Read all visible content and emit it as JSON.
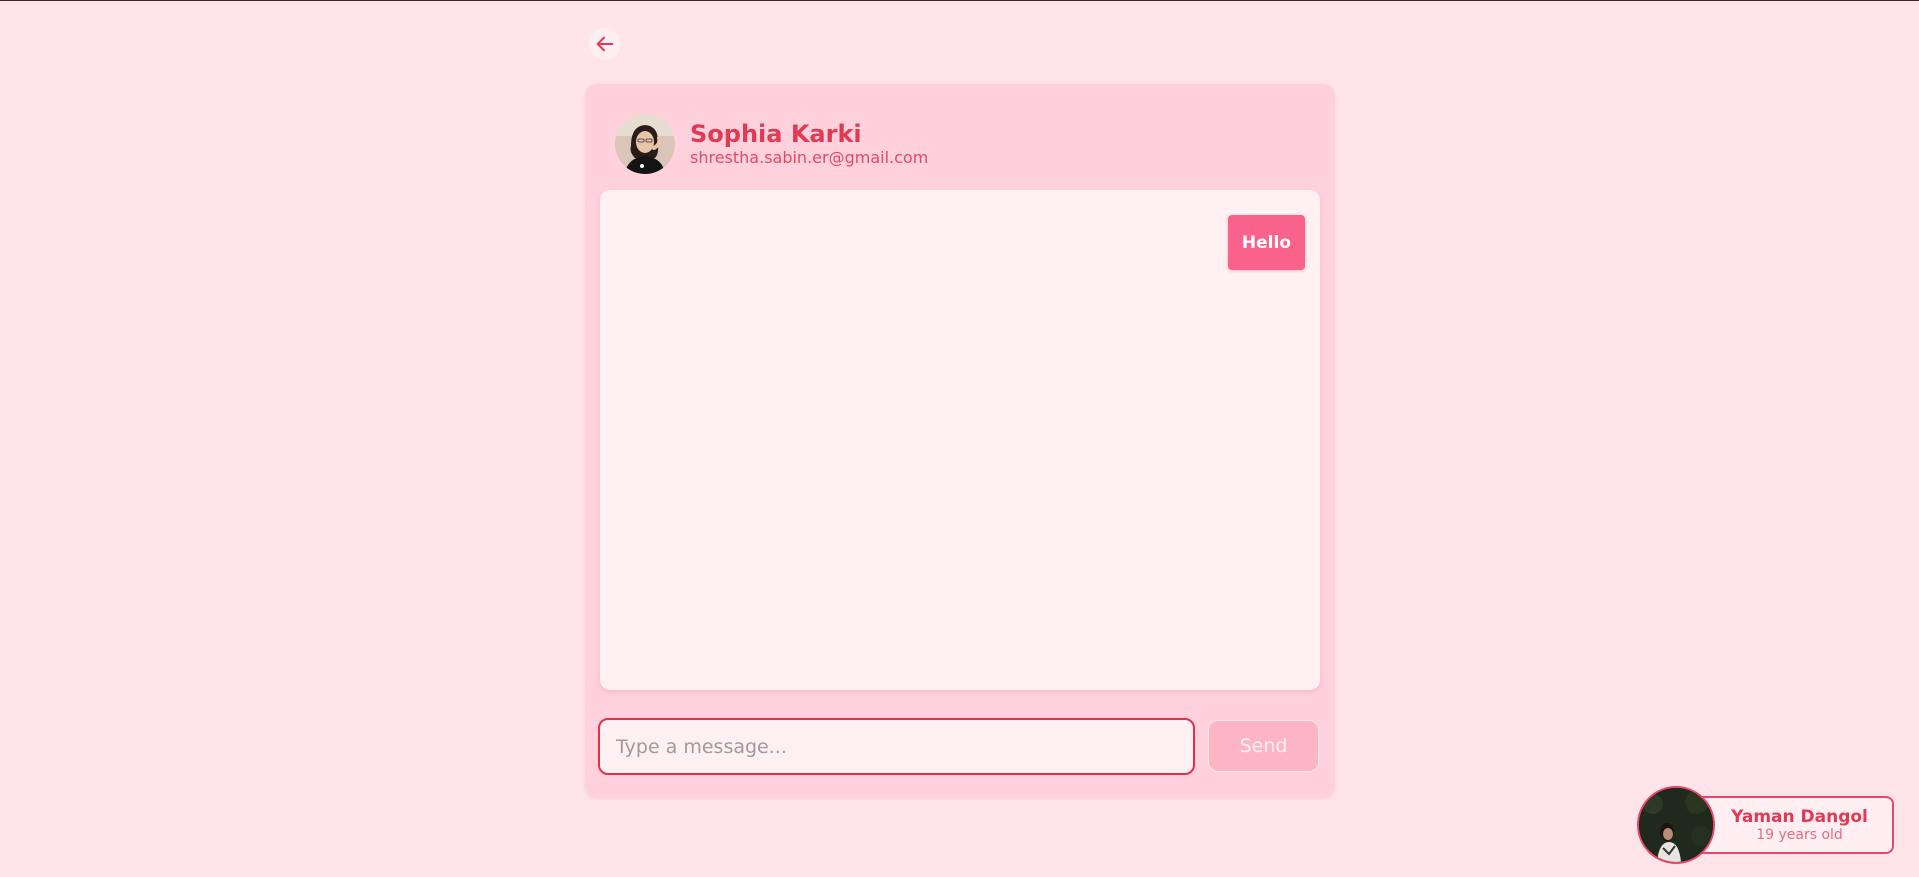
{
  "navigation": {
    "back_icon": "arrow-left-icon"
  },
  "chat": {
    "contact": {
      "name": "Sophia Karki",
      "email": "shrestha.sabin.er@gmail.com"
    },
    "messages": [
      {
        "text": "Hello",
        "sender": "me"
      }
    ],
    "composer": {
      "placeholder": "Type a message...",
      "value": "",
      "send_label": "Send"
    }
  },
  "user_profile": {
    "name": "Yaman Dangol",
    "age_text": "19 years old"
  },
  "colors": {
    "page_background": "#ffe4ea",
    "card_background": "#ffd1dc",
    "accent": "#e03a55",
    "bubble": "#f8628b",
    "send_disabled": "#fdb4c4"
  }
}
